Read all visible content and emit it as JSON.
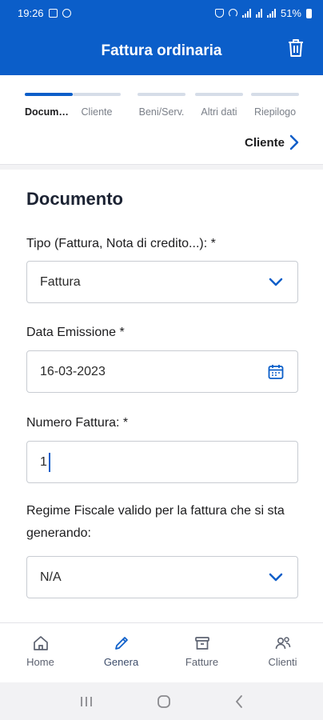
{
  "status_bar": {
    "time": "19:26",
    "battery": "51%"
  },
  "app_bar": {
    "title": "Fattura ordinaria",
    "action_icon": "trash-icon"
  },
  "steps": [
    {
      "label": "Documento",
      "active": true
    },
    {
      "label": "Cliente",
      "active": false
    },
    {
      "label": "Beni/Serv.",
      "active": false
    },
    {
      "label": "Altri dati",
      "active": false
    },
    {
      "label": "Riepilogo",
      "active": false
    }
  ],
  "next_step": {
    "label": "Cliente",
    "icon": "chevron-right-icon"
  },
  "form": {
    "section_title": "Documento",
    "tipo": {
      "label": "Tipo (Fattura, Nota di credito...): *",
      "value": "Fattura",
      "icon": "chevron-down-icon"
    },
    "data_emissione": {
      "label": "Data Emissione *",
      "value": "16-03-2023",
      "icon": "calendar-icon"
    },
    "numero": {
      "label": "Numero Fattura: *",
      "value": "1"
    },
    "regime": {
      "label": "Regime Fiscale valido per la fattura che si sta generando:",
      "value": "N/A",
      "icon": "chevron-down-icon"
    }
  },
  "bottom_nav": [
    {
      "label": "Home",
      "icon": "home-icon",
      "active": false
    },
    {
      "label": "Genera",
      "icon": "pencil-icon",
      "active": true
    },
    {
      "label": "Fatture",
      "icon": "archive-icon",
      "active": false
    },
    {
      "label": "Clienti",
      "icon": "users-icon",
      "active": false
    }
  ],
  "colors": {
    "primary": "#0b5ec9",
    "inactive_step": "#d6dde8"
  }
}
